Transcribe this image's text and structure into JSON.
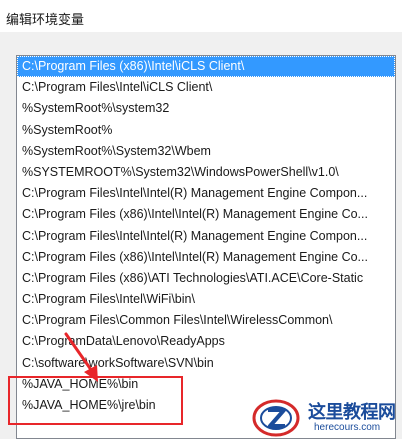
{
  "window": {
    "title": "编辑环境变量"
  },
  "path_list": {
    "items": [
      "C:\\Program Files (x86)\\Intel\\iCLS Client\\",
      "C:\\Program Files\\Intel\\iCLS Client\\",
      "%SystemRoot%\\system32",
      "%SystemRoot%",
      "%SystemRoot%\\System32\\Wbem",
      "%SYSTEMROOT%\\System32\\WindowsPowerShell\\v1.0\\",
      "C:\\Program Files\\Intel\\Intel(R) Management Engine Compon...",
      "C:\\Program Files (x86)\\Intel\\Intel(R) Management Engine Co...",
      "C:\\Program Files\\Intel\\Intel(R) Management Engine Compon...",
      "C:\\Program Files (x86)\\Intel\\Intel(R) Management Engine Co...",
      "C:\\Program Files (x86)\\ATI Technologies\\ATI.ACE\\Core-Static",
      "C:\\Program Files\\Intel\\WiFi\\bin\\",
      "C:\\Program Files\\Common Files\\Intel\\WirelessCommon\\",
      "C:\\ProgramData\\Lenovo\\ReadyApps",
      "C:\\software\\workSoftware\\SVN\\bin",
      "%JAVA_HOME%\\bin",
      "%JAVA_HOME%\\jre\\bin"
    ],
    "selected_index": 0,
    "selection_color": "#3399ff"
  },
  "annotation": {
    "color": "#e8262a"
  },
  "watermark": {
    "name": "这里教程网",
    "url": "herecours.com"
  }
}
